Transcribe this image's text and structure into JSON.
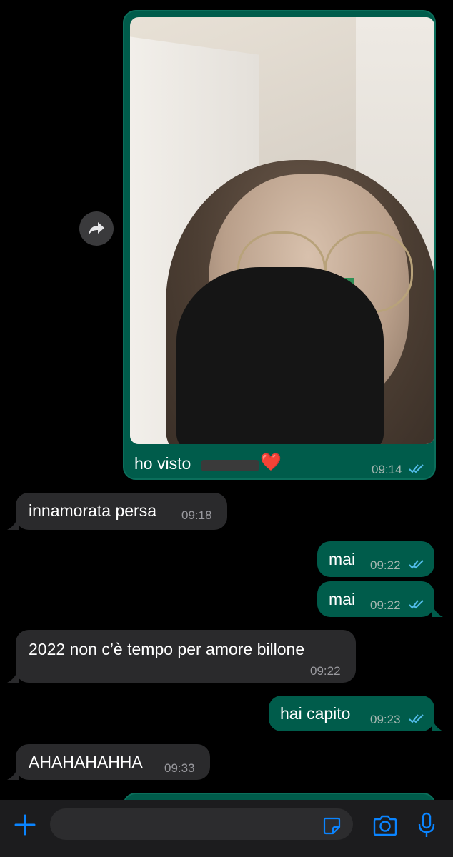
{
  "conversation": {
    "messages": [
      {
        "id": "m1",
        "direction": "outgoing",
        "type": "image",
        "caption_visible": "ho visto",
        "caption_redacted": true,
        "emoji": "❤️",
        "time": "09:14",
        "status": "read"
      },
      {
        "id": "m2",
        "direction": "incoming",
        "text": "innamorata persa",
        "time": "09:18"
      },
      {
        "id": "m3",
        "direction": "outgoing",
        "text": "mai",
        "time": "09:22",
        "status": "read"
      },
      {
        "id": "m4",
        "direction": "outgoing",
        "text": "mai",
        "time": "09:22",
        "status": "read"
      },
      {
        "id": "m5",
        "direction": "incoming",
        "text": "2022 non c’è tempo per amore billone",
        "time": "09:22"
      },
      {
        "id": "m6",
        "direction": "outgoing",
        "text": "hai capito",
        "time": "09:23",
        "status": "read"
      },
      {
        "id": "m7",
        "direction": "incoming",
        "text": "AHAHAHAHHA",
        "time": "09:33"
      }
    ]
  },
  "input_bar": {
    "add_icon": "plus-icon",
    "sticker_icon": "sticker-icon",
    "camera_icon": "camera-icon",
    "mic_icon": "microphone-icon"
  },
  "colors": {
    "outgoing": "#005c4b",
    "incoming": "#2a2a2c",
    "accent": "#0a84ff",
    "background": "#000000"
  }
}
